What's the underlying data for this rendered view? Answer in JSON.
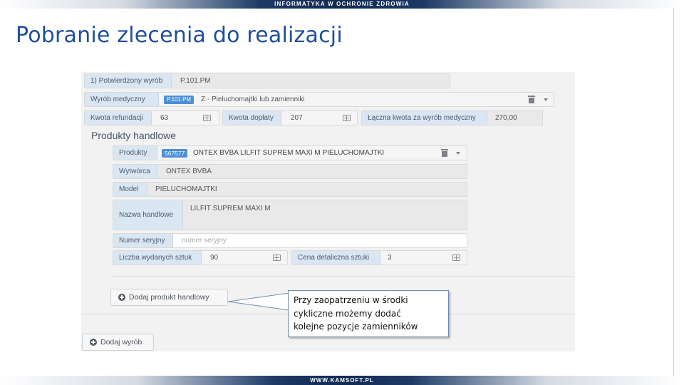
{
  "header": {
    "banner": "INFORMATYKA W OCHRONIE ZDROWIA"
  },
  "footer": {
    "banner": "WWW.KAMSOFT.PL"
  },
  "slide": {
    "title": "Pobranie zlecenia do realizacji"
  },
  "form": {
    "confirmed_product": {
      "label": "1) Potwierdzony wyrób",
      "value": "P.101.PM"
    },
    "medical_product": {
      "label": "Wyrób medyczny",
      "badge": "P.101.PM",
      "value": "Z - Pieluchomajtki lub zamienniki"
    },
    "refund_amount": {
      "label": "Kwota refundacji",
      "value": "63"
    },
    "surcharge_amount": {
      "label": "Kwota dopłaty",
      "value": "207"
    },
    "total_amount": {
      "label": "Łączna kwota za wyrób medyczny",
      "value": "270,00"
    },
    "section_title": "Produkty handlowe",
    "products": {
      "label": "Produkty",
      "badge": "567577",
      "value": "ONTEX BVBA LILFIT SUPREM MAXI M PIELUCHOMAJTKI"
    },
    "manufacturer": {
      "label": "Wytwórca",
      "value": "ONTEX BVBA"
    },
    "model": {
      "label": "Model",
      "value": "PIELUCHOMAJTKI"
    },
    "trade_name": {
      "label": "Nazwa handlowe",
      "value": "LILFIT SUPREM MAXI M"
    },
    "serial_number": {
      "label": "Numer seryjny",
      "placeholder": "numer seryjny"
    },
    "quantity": {
      "label": "Liczba wydanych sztuk",
      "value": "90"
    },
    "retail_price": {
      "label": "Cena detaliczna sztuki",
      "value": "3"
    },
    "add_trade_product": "Dodaj produkt handlowy",
    "add_product": "Dodaj wyrób"
  },
  "callout": {
    "lines": [
      "Przy zaopatrzeniu w środki",
      "cykliczne możemy dodać",
      "kolejne pozycje zamienników"
    ]
  },
  "icons": [
    "trash-icon",
    "chevron-down-icon",
    "spinner-icon",
    "plus-circle-icon"
  ]
}
